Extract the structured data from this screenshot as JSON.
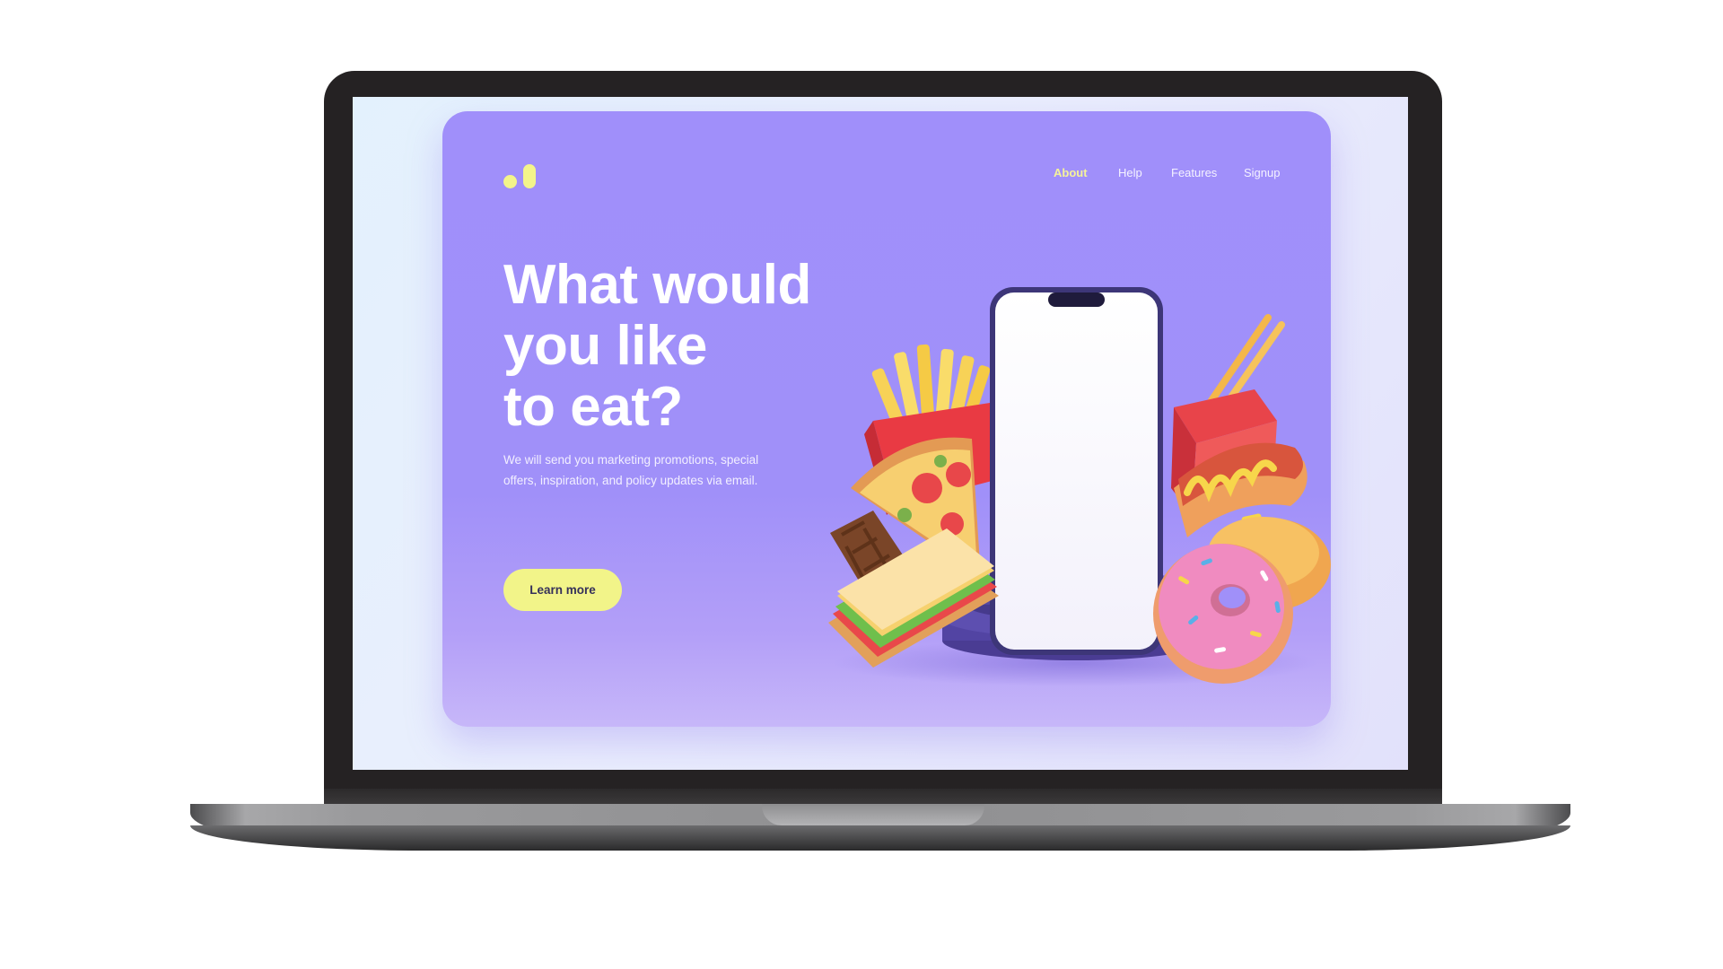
{
  "page": {
    "nav": {
      "items": [
        {
          "label": "About",
          "active": true
        },
        {
          "label": "Help",
          "active": false
        },
        {
          "label": "Features",
          "active": false
        },
        {
          "label": "Signup",
          "active": false
        }
      ]
    },
    "hero": {
      "headline_lines": [
        "What would",
        "you like",
        "to eat?"
      ],
      "description": "We will send you marketing promotions, special offers, inspiration, and policy updates via email.",
      "cta_label": "Learn more"
    }
  },
  "colors": {
    "card_background": "#a08ffa",
    "accent_yellow": "#f2f489",
    "laptop_frame": "#252223",
    "phone_frame": "#3d3678",
    "podium": "#5a4ba6"
  },
  "icons": {
    "logo": "dot-and-bar-logo",
    "food": [
      "fries",
      "pizza",
      "chocolate",
      "sandwich",
      "chopsticks-box",
      "hot-dog",
      "donut",
      "pancakes"
    ]
  }
}
